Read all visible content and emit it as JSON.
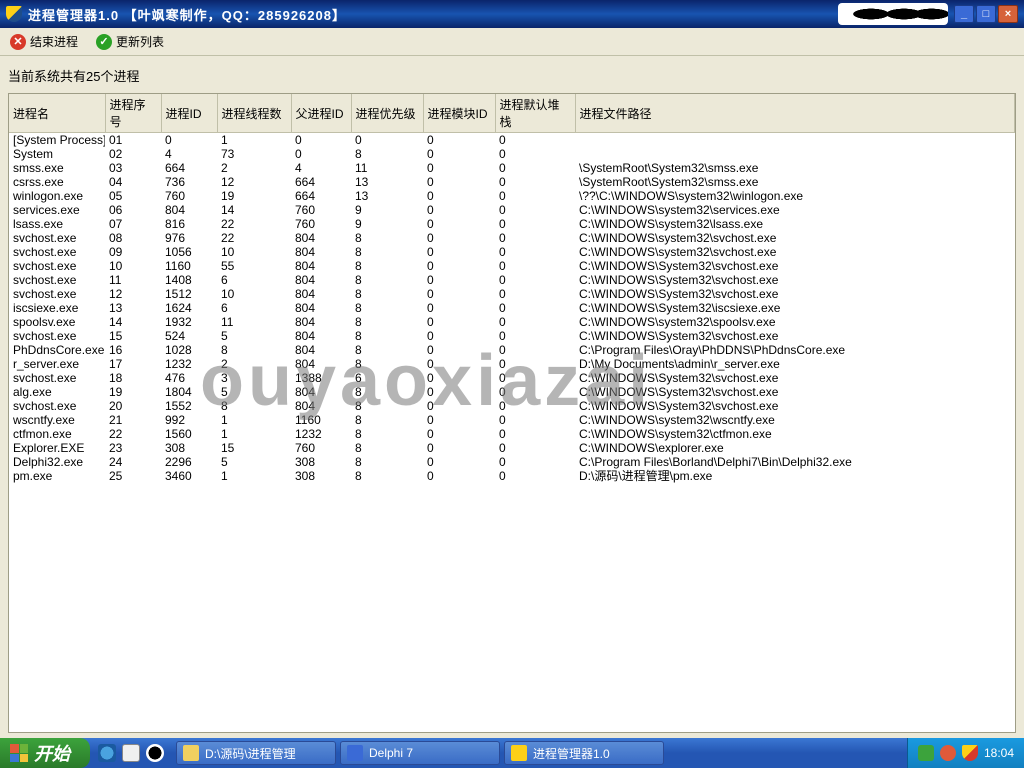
{
  "titlebar": {
    "title": "进程管理器1.0    【叶飒寒制作，QQ：285926208】"
  },
  "toolbar": {
    "end_process": "结束进程",
    "refresh": "更新列表"
  },
  "status": {
    "text": "当前系统共有25个进程"
  },
  "columns": [
    "进程名",
    "进程序号",
    "进程ID",
    "进程线程数",
    "父进程ID",
    "进程优先级",
    "进程模块ID",
    "进程默认堆栈",
    "进程文件路径"
  ],
  "rows": [
    [
      "[System Process]",
      "01",
      "0",
      "1",
      "0",
      "0",
      "0",
      "0",
      ""
    ],
    [
      "System",
      "02",
      "4",
      "73",
      "0",
      "8",
      "0",
      "0",
      ""
    ],
    [
      "smss.exe",
      "03",
      "664",
      "2",
      "4",
      "11",
      "0",
      "0",
      "\\SystemRoot\\System32\\smss.exe"
    ],
    [
      "csrss.exe",
      "04",
      "736",
      "12",
      "664",
      "13",
      "0",
      "0",
      "\\SystemRoot\\System32\\smss.exe"
    ],
    [
      "winlogon.exe",
      "05",
      "760",
      "19",
      "664",
      "13",
      "0",
      "0",
      "\\??\\C:\\WINDOWS\\system32\\winlogon.exe"
    ],
    [
      "services.exe",
      "06",
      "804",
      "14",
      "760",
      "9",
      "0",
      "0",
      "C:\\WINDOWS\\system32\\services.exe"
    ],
    [
      "lsass.exe",
      "07",
      "816",
      "22",
      "760",
      "9",
      "0",
      "0",
      "C:\\WINDOWS\\system32\\lsass.exe"
    ],
    [
      "svchost.exe",
      "08",
      "976",
      "22",
      "804",
      "8",
      "0",
      "0",
      "C:\\WINDOWS\\system32\\svchost.exe"
    ],
    [
      "svchost.exe",
      "09",
      "1056",
      "10",
      "804",
      "8",
      "0",
      "0",
      "C:\\WINDOWS\\system32\\svchost.exe"
    ],
    [
      "svchost.exe",
      "10",
      "1160",
      "55",
      "804",
      "8",
      "0",
      "0",
      "C:\\WINDOWS\\System32\\svchost.exe"
    ],
    [
      "svchost.exe",
      "11",
      "1408",
      "6",
      "804",
      "8",
      "0",
      "0",
      "C:\\WINDOWS\\System32\\svchost.exe"
    ],
    [
      "svchost.exe",
      "12",
      "1512",
      "10",
      "804",
      "8",
      "0",
      "0",
      "C:\\WINDOWS\\System32\\svchost.exe"
    ],
    [
      "iscsiexe.exe",
      "13",
      "1624",
      "6",
      "804",
      "8",
      "0",
      "0",
      "C:\\WINDOWS\\System32\\iscsiexe.exe"
    ],
    [
      "spoolsv.exe",
      "14",
      "1932",
      "11",
      "804",
      "8",
      "0",
      "0",
      "C:\\WINDOWS\\system32\\spoolsv.exe"
    ],
    [
      "svchost.exe",
      "15",
      "524",
      "5",
      "804",
      "8",
      "0",
      "0",
      "C:\\WINDOWS\\System32\\svchost.exe"
    ],
    [
      "PhDdnsCore.exe",
      "16",
      "1028",
      "8",
      "804",
      "8",
      "0",
      "0",
      "C:\\Program Files\\Oray\\PhDDNS\\PhDdnsCore.exe"
    ],
    [
      "r_server.exe",
      "17",
      "1232",
      "2",
      "804",
      "8",
      "0",
      "0",
      "D:\\My Documents\\admin\\r_server.exe"
    ],
    [
      "svchost.exe",
      "18",
      "476",
      "3",
      "1388",
      "6",
      "0",
      "0",
      "C:\\WINDOWS\\System32\\svchost.exe"
    ],
    [
      "alg.exe",
      "19",
      "1804",
      "5",
      "804",
      "8",
      "0",
      "0",
      "C:\\WINDOWS\\System32\\svchost.exe"
    ],
    [
      "svchost.exe",
      "20",
      "1552",
      "8",
      "804",
      "8",
      "0",
      "0",
      "C:\\WINDOWS\\System32\\svchost.exe"
    ],
    [
      "wscntfy.exe",
      "21",
      "992",
      "1",
      "1160",
      "8",
      "0",
      "0",
      "C:\\WINDOWS\\system32\\wscntfy.exe"
    ],
    [
      "ctfmon.exe",
      "22",
      "1560",
      "1",
      "1232",
      "8",
      "0",
      "0",
      "C:\\WINDOWS\\system32\\ctfmon.exe"
    ],
    [
      "Explorer.EXE",
      "23",
      "308",
      "15",
      "760",
      "8",
      "0",
      "0",
      "C:\\WINDOWS\\explorer.exe"
    ],
    [
      "Delphi32.exe",
      "24",
      "2296",
      "5",
      "308",
      "8",
      "0",
      "0",
      "C:\\Program Files\\Borland\\Delphi7\\Bin\\Delphi32.exe"
    ],
    [
      "pm.exe",
      "25",
      "3460",
      "1",
      "308",
      "8",
      "0",
      "0",
      "D:\\源码\\进程管理\\pm.exe"
    ]
  ],
  "watermark": "ouyaoxiazai",
  "taskbar": {
    "start": "开始",
    "tasks": [
      "D:\\源码\\进程管理",
      "Delphi 7",
      "进程管理器1.0"
    ],
    "clock": "18:04"
  }
}
